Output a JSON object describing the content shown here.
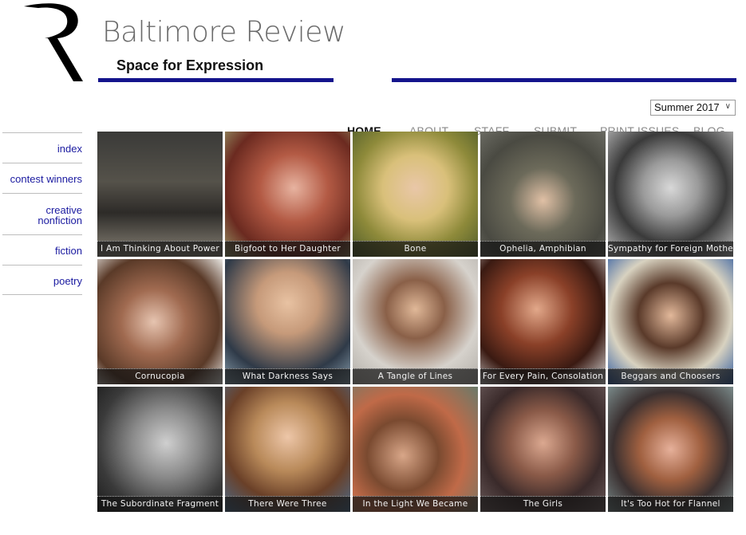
{
  "header": {
    "site_title": "Baltimore Review",
    "tagline": "Space for Expression"
  },
  "nav": [
    {
      "label": "HOME",
      "active": true
    },
    {
      "label": "ABOUT",
      "active": false
    },
    {
      "label": "STAFF",
      "active": false
    },
    {
      "label": "SUBMIT",
      "active": false
    },
    {
      "label": "PRINT ISSUES",
      "active": false
    },
    {
      "label": "BLOG",
      "active": false
    }
  ],
  "issue_select": {
    "value": "Summer 2017"
  },
  "sidebar": [
    {
      "label": "index"
    },
    {
      "label": "contest winners"
    },
    {
      "label": "creative nonfiction"
    },
    {
      "label": "fiction"
    },
    {
      "label": "poetry"
    }
  ],
  "colors": {
    "brand_bar": "#14148c",
    "sidebar_link": "#1a1aa0"
  },
  "tiles": [
    {
      "caption": "I Am Thinking About Power"
    },
    {
      "caption": "Bigfoot to Her Daughter"
    },
    {
      "caption": "Bone"
    },
    {
      "caption": "Ophelia, Amphibian"
    },
    {
      "caption": "Sympathy for Foreign Mothers"
    },
    {
      "caption": "Cornucopia"
    },
    {
      "caption": "What Darkness Says"
    },
    {
      "caption": "A Tangle of Lines"
    },
    {
      "caption": "For Every Pain, Consolation"
    },
    {
      "caption": "Beggars and Choosers"
    },
    {
      "caption": "The Subordinate Fragment"
    },
    {
      "caption": "There Were Three"
    },
    {
      "caption": "In the Light We Became"
    },
    {
      "caption": "The Girls"
    },
    {
      "caption": "It's Too Hot for Flannel"
    }
  ]
}
